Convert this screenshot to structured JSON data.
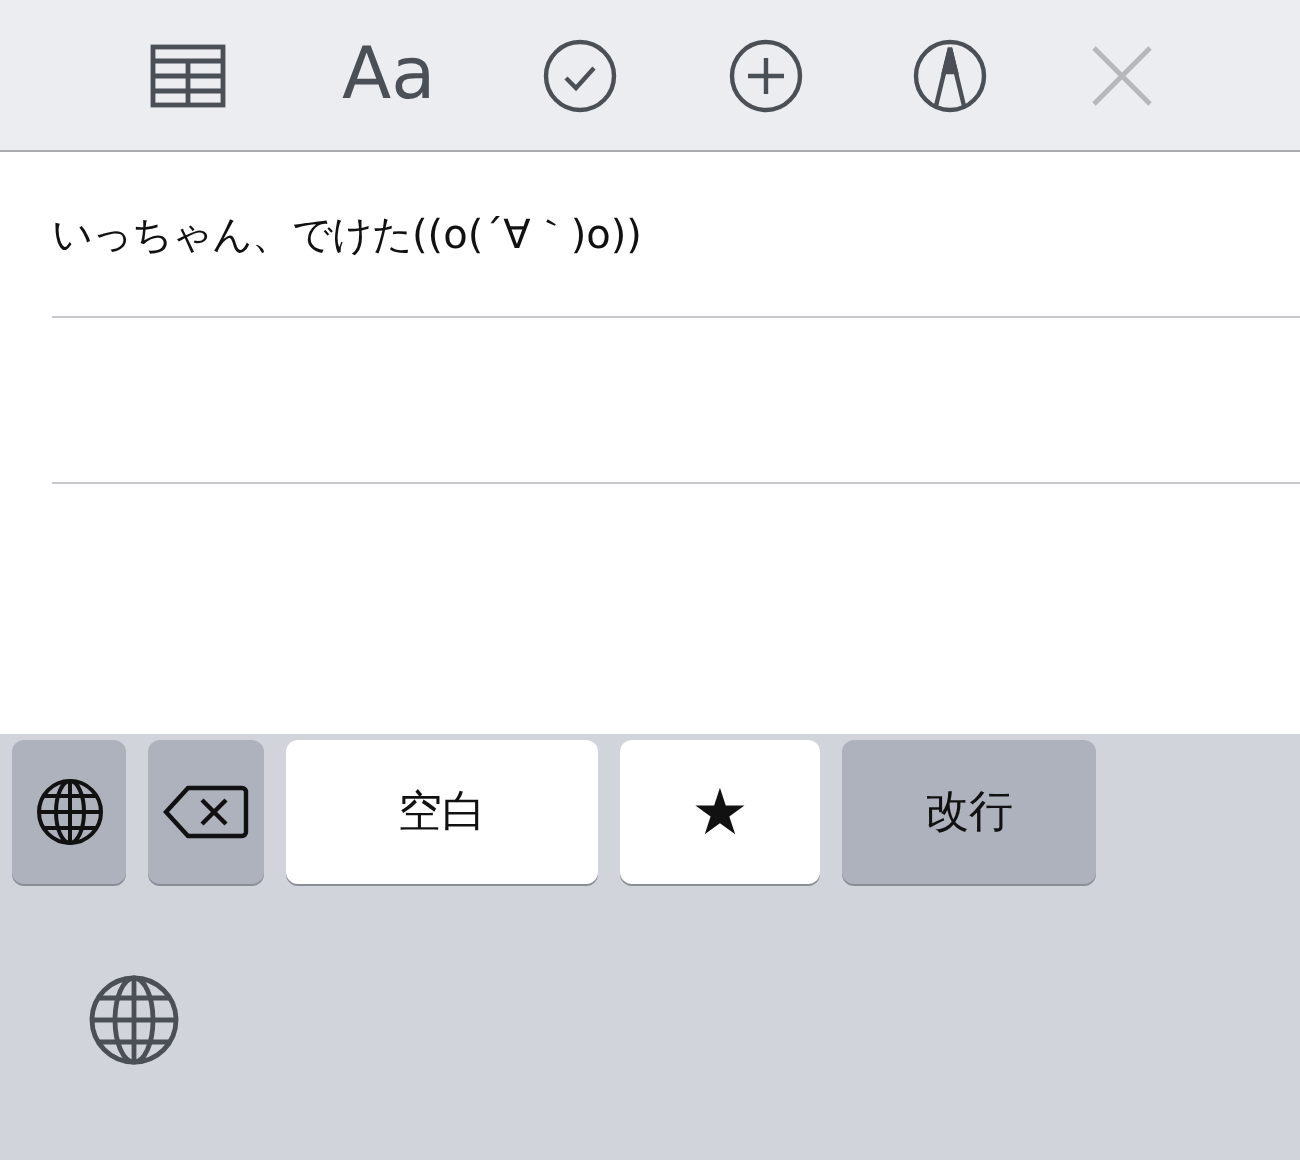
{
  "toolbar": {
    "format_label": "Aa",
    "close": {
      "disabled": true
    }
  },
  "note": {
    "text": "いっちゃん、でけた((o(´∀｀)o))"
  },
  "keyboard": {
    "keys": [
      {
        "kind": "globe"
      },
      {
        "kind": "backspace"
      },
      {
        "kind": "space",
        "label": "空白"
      },
      {
        "kind": "char",
        "label": "★"
      },
      {
        "kind": "return",
        "label": "改行"
      }
    ]
  }
}
